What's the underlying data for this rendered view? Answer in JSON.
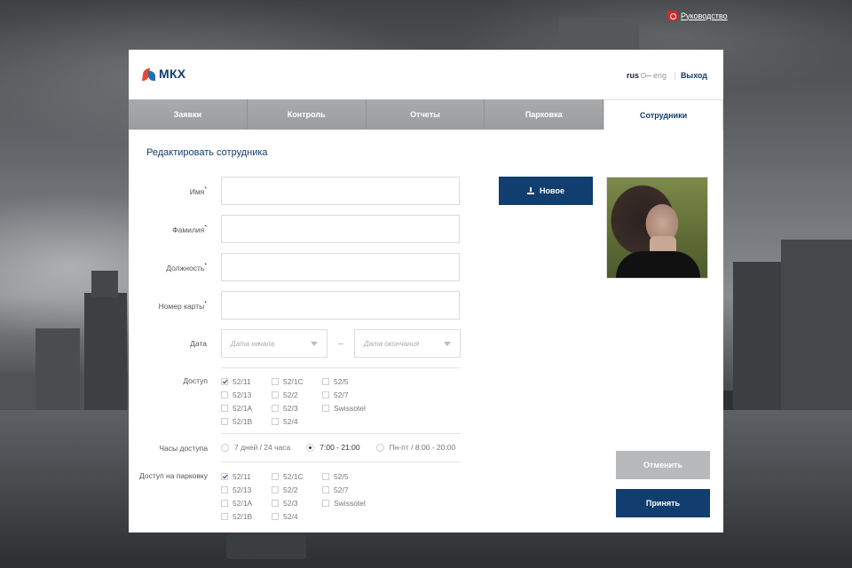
{
  "guide": {
    "label": "Руководство",
    "icon": "pdf-icon"
  },
  "header": {
    "logo_text": "МКХ",
    "lang_rus": "rus",
    "lang_eng": "eng",
    "separator": "|",
    "logout": "Выход"
  },
  "tabs": [
    {
      "label": "Заявки"
    },
    {
      "label": "Контроль"
    },
    {
      "label": "Отчеты"
    },
    {
      "label": "Парковка"
    },
    {
      "label": "Сотрудники"
    }
  ],
  "active_tab": "Сотрудники",
  "form": {
    "title": "Редактировать сотрудника",
    "fields": [
      {
        "label": "Имя",
        "value": ""
      },
      {
        "label": "Фамилия",
        "value": ""
      },
      {
        "label": "Должность",
        "value": ""
      },
      {
        "label": "Номер карты",
        "value": ""
      }
    ],
    "required_mark": "*",
    "date": {
      "label": "Дата",
      "start_placeholder": "Дата начала",
      "end_placeholder": "Дата окончания",
      "dash": "–"
    },
    "access": {
      "label": "Доступ",
      "options": [
        {
          "label": "52/11",
          "checked": true
        },
        {
          "label": "52/1С",
          "checked": false
        },
        {
          "label": "52/5",
          "checked": false
        },
        {
          "label": "52/13",
          "checked": false
        },
        {
          "label": "52/2",
          "checked": false
        },
        {
          "label": "52/7",
          "checked": false
        },
        {
          "label": "52/1А",
          "checked": false
        },
        {
          "label": "52/3",
          "checked": false
        },
        {
          "label": "Swissotel",
          "checked": false
        },
        {
          "label": "52/1В",
          "checked": false
        },
        {
          "label": "52/4",
          "checked": false
        }
      ]
    },
    "hours": {
      "label": "Часы доступа",
      "options": [
        {
          "label": "7 дней / 24 часа",
          "checked": false
        },
        {
          "label": "7:00 - 21:00",
          "checked": true
        },
        {
          "label": "Пн-пт / 8:00 - 20:00",
          "checked": false
        }
      ]
    },
    "parking": {
      "label": "Доступ на парковку",
      "options": [
        {
          "label": "52/11",
          "checked": true
        },
        {
          "label": "52/1С",
          "checked": false
        },
        {
          "label": "52/5",
          "checked": false
        },
        {
          "label": "52/13",
          "checked": false
        },
        {
          "label": "52/2",
          "checked": false
        },
        {
          "label": "52/7",
          "checked": false
        },
        {
          "label": "52/1А",
          "checked": false
        },
        {
          "label": "52/3",
          "checked": false
        },
        {
          "label": "Swissotel",
          "checked": false
        },
        {
          "label": "52/1В",
          "checked": false
        },
        {
          "label": "52/4",
          "checked": false
        }
      ]
    }
  },
  "buttons": {
    "new": "Новое",
    "cancel": "Отменить",
    "accept": "Принять"
  },
  "colors": {
    "primary": "#113e6e",
    "tab_bar": "#a3a4a6",
    "cancel_bg": "#b8b9ba",
    "guide_icon": "#d9262c"
  }
}
